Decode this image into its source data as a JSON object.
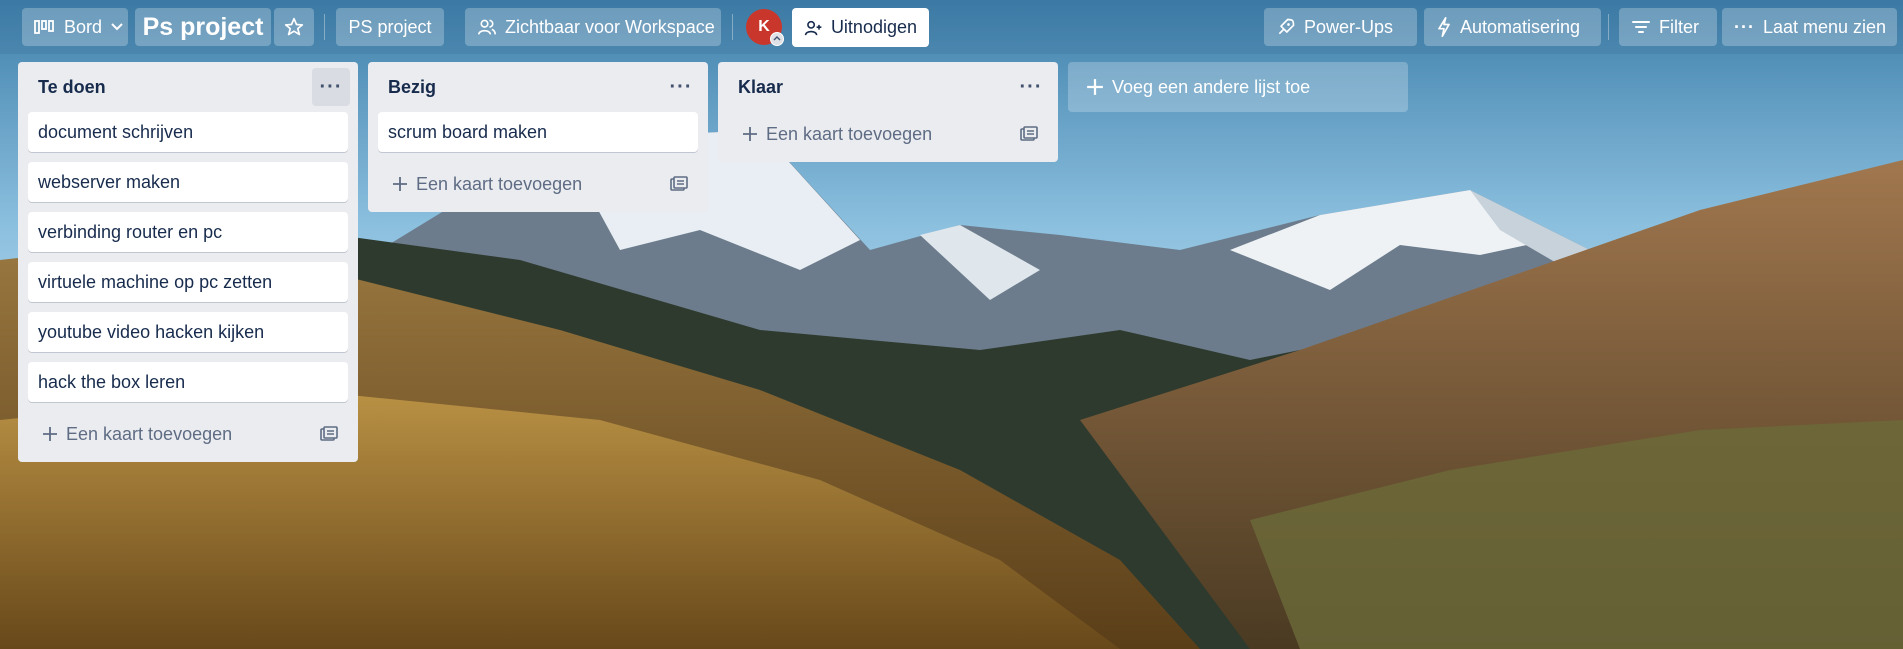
{
  "header": {
    "view_switcher": {
      "label": "Bord",
      "icon": "board-icon"
    },
    "board_title": "Ps project",
    "workspace": "PS project",
    "visibility": "Zichtbaar voor Workspace",
    "avatar_initial": "K",
    "invite": "Uitnodigen",
    "power_ups": "Power-Ups",
    "automation": "Automatisering",
    "filter": "Filter",
    "menu": "Laat menu zien"
  },
  "lists": [
    {
      "title": "Te doen",
      "cards": [
        "document schrijven",
        "webserver maken",
        "verbinding router en pc",
        "virtuele machine op pc zetten",
        "youtube video hacken kijken",
        "hack the box leren"
      ],
      "add_card": "Een kaart toevoegen"
    },
    {
      "title": "Bezig",
      "cards": [
        "scrum board maken"
      ],
      "add_card": "Een kaart toevoegen"
    },
    {
      "title": "Klaar",
      "cards": [],
      "add_card": "Een kaart toevoegen"
    }
  ],
  "add_list": "Voeg een andere lijst toe",
  "colors": {
    "list_bg": "#ebecf0",
    "avatar": "#c9372c",
    "text": "#172b4d",
    "muted": "#5e6c84"
  }
}
